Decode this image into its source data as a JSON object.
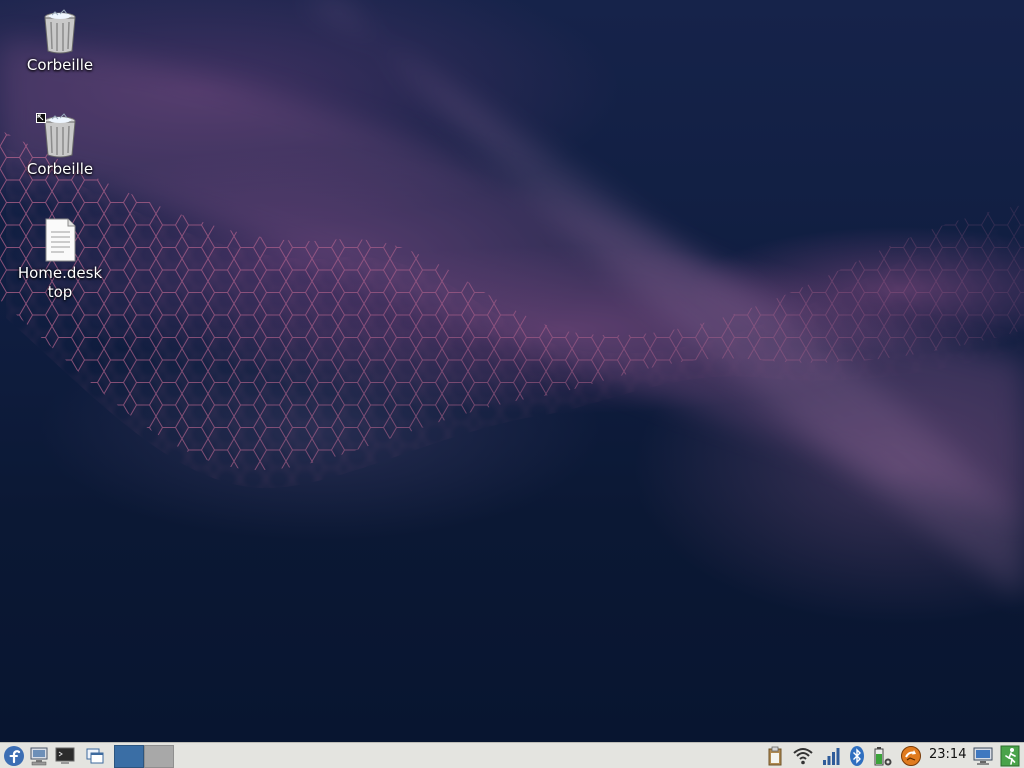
{
  "desktop": {
    "icons": [
      {
        "label": "Corbeille",
        "icon": "trash-icon"
      },
      {
        "label": "Corbeille",
        "icon": "trash-icon"
      },
      {
        "label": "Home.desktop",
        "icon": "text-file-icon"
      }
    ]
  },
  "taskbar": {
    "launchers": [
      {
        "icon": "fedora-menu-icon"
      },
      {
        "icon": "computer-icon"
      },
      {
        "icon": "terminal-icon"
      },
      {
        "icon": "window-switcher-icon"
      }
    ],
    "workspaces": [
      {
        "icon": "workspace-1",
        "active": true
      },
      {
        "icon": "workspace-2",
        "active": false
      }
    ],
    "tray": [
      {
        "icon": "clipboard-icon"
      },
      {
        "icon": "wifi-icon"
      },
      {
        "icon": "signal-bars-icon"
      },
      {
        "icon": "bluetooth-icon"
      },
      {
        "icon": "battery-icon"
      },
      {
        "icon": "update-icon"
      }
    ],
    "clock": "23:14",
    "right_icons": [
      {
        "icon": "network-monitor-icon"
      },
      {
        "icon": "logout-icon"
      }
    ]
  },
  "colors": {
    "taskbar_bg": "#e4e4e0",
    "workspace_active": "#3a6ea5",
    "workspace_inactive": "#a8a8a8",
    "fedora_blue": "#3c6eb4"
  }
}
